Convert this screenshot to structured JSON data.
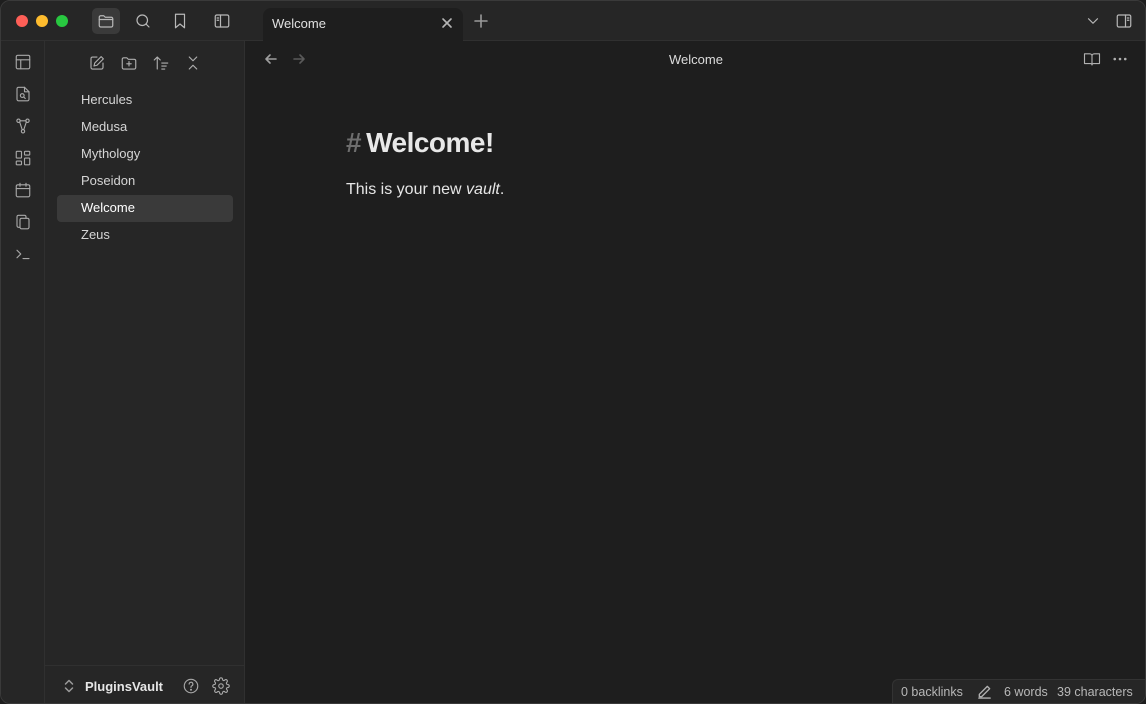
{
  "tab": {
    "title": "Welcome"
  },
  "sidebar": {
    "files": [
      "Hercules",
      "Medusa",
      "Mythology",
      "Poseidon",
      "Welcome",
      "Zeus"
    ],
    "selected": "Welcome",
    "vault_name": "PluginsVault"
  },
  "view": {
    "title": "Welcome"
  },
  "document": {
    "heading_marker": "#",
    "heading": "Welcome!",
    "para_prefix": "This is your new ",
    "para_emphasis": "vault",
    "para_suffix": "."
  },
  "status": {
    "backlinks": "0 backlinks",
    "words": "6 words",
    "characters": "39 characters"
  },
  "icons": {
    "titlebar": [
      "folder-icon",
      "search-icon",
      "bookmark-icon",
      "sidebar-toggle-icon"
    ],
    "ribbon": [
      "layout-icon",
      "file-search-icon",
      "graph-icon",
      "canvas-icon",
      "calendar-icon",
      "files-icon",
      "terminal-icon"
    ]
  },
  "colors": {
    "background": "#1e1e1e",
    "panel": "#262626",
    "selected": "#3a3a3a"
  }
}
